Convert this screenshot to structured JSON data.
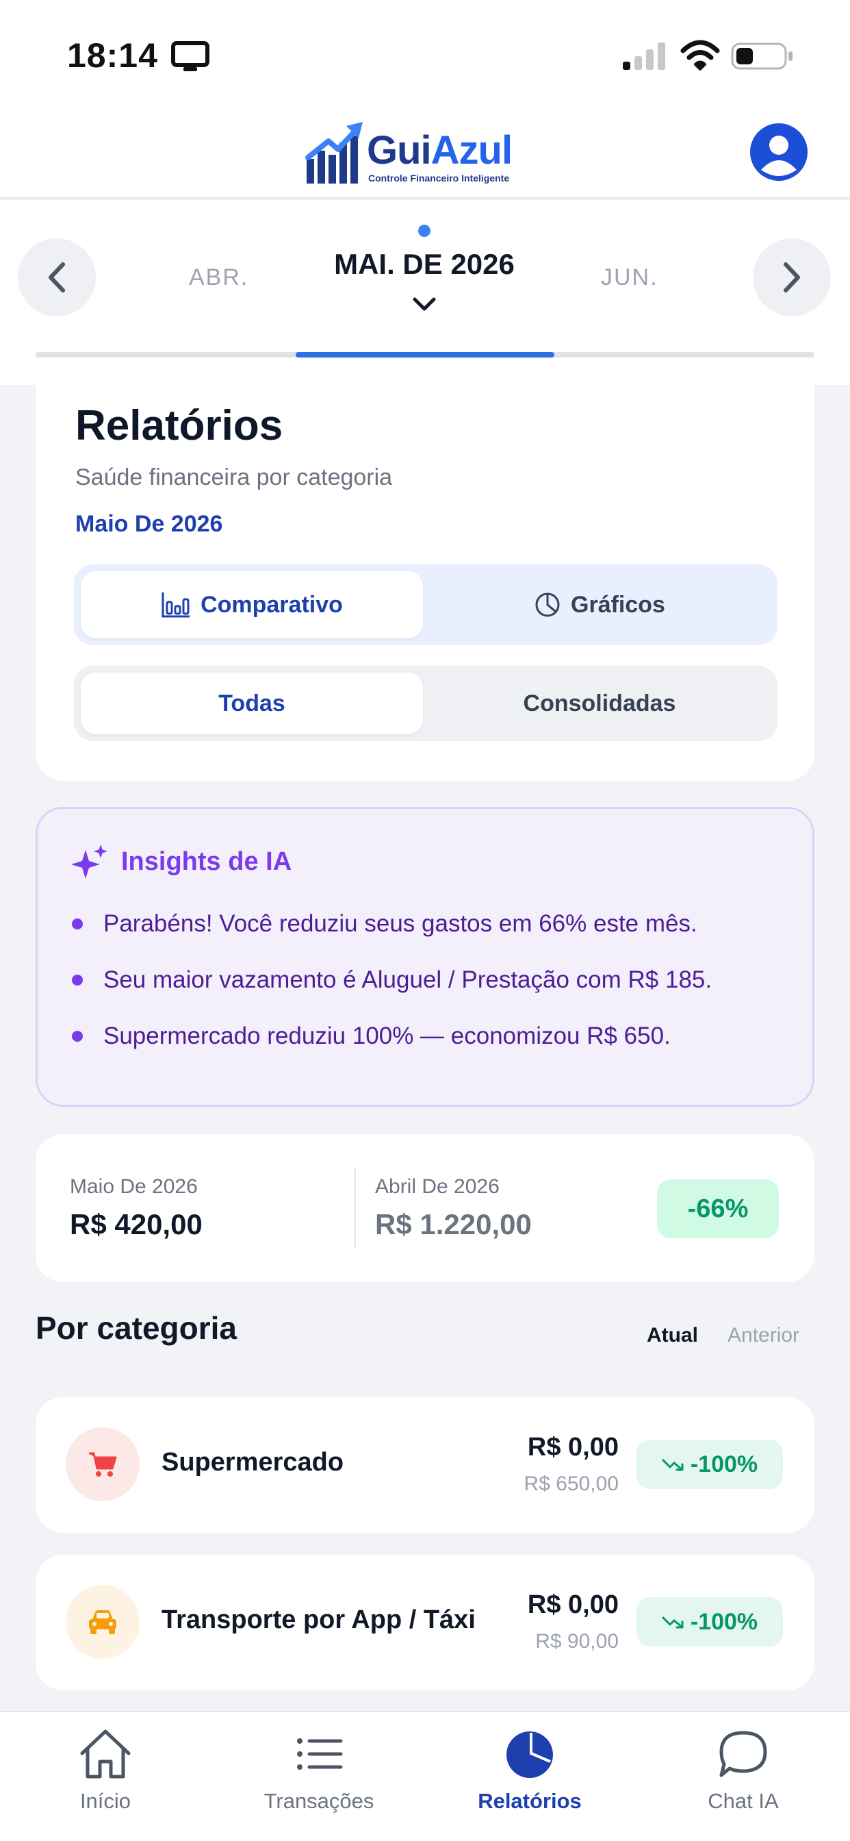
{
  "status_bar": {
    "time": "18:14",
    "icons": [
      "screen-mirroring-icon",
      "cellular-signal-icon",
      "wifi-icon",
      "battery-icon"
    ]
  },
  "header": {
    "brand_part1": "Gui",
    "brand_part2": "Azul",
    "tagline": "Controle Financeiro Inteligente",
    "avatar_icon": "user-avatar-icon"
  },
  "month_selector": {
    "previous": "ABR.",
    "current": "MAI. DE 2026",
    "next": "JUN.",
    "progress_fraction": 0.33
  },
  "reports": {
    "title": "Relatórios",
    "subtitle": "Saúde financeira por categoria",
    "period": "Maio De 2026",
    "view_tabs": [
      {
        "label": "Comparativo",
        "icon": "bar-chart-icon",
        "active": true
      },
      {
        "label": "Gráficos",
        "icon": "pie-chart-icon",
        "active": false
      }
    ],
    "filter_tabs": [
      {
        "label": "Todas",
        "active": true
      },
      {
        "label": "Consolidadas",
        "active": false
      }
    ]
  },
  "insights": {
    "title": "Insights de IA",
    "icon": "sparkles-icon",
    "items": [
      "Parabéns! Você reduziu seus gastos em 66% este mês.",
      "Seu maior vazamento é Aluguel / Prestação com R$ 185.",
      "Supermercado reduziu 100% — economizou R$ 650."
    ]
  },
  "summary": {
    "current_label": "Maio De 2026",
    "current_value": "R$ 420,00",
    "previous_label": "Abril De 2026",
    "previous_value": "R$ 1.220,00",
    "change": "-66%"
  },
  "categories": {
    "title": "Por categoria",
    "toggle_current": "Atual",
    "toggle_previous": "Anterior",
    "items": [
      {
        "name": "Supermercado",
        "icon": "shopping-cart-icon",
        "current": "R$ 0,00",
        "previous": "R$ 650,00",
        "change": "-100%"
      },
      {
        "name": "Transporte por App / Táxi",
        "icon": "car-icon",
        "current": "R$ 0,00",
        "previous": "R$ 90,00",
        "change": "-100%"
      }
    ]
  },
  "colors": {
    "primary": "#1e40af",
    "accent": "#2f6fe4",
    "insight_purple": "#7c3aed",
    "positive_green": "#059669"
  },
  "tab_bar": {
    "items": [
      {
        "label": "Início",
        "icon": "home-icon",
        "active": false
      },
      {
        "label": "Transações",
        "icon": "list-icon",
        "active": false
      },
      {
        "label": "Relatórios",
        "icon": "pie-chart-icon",
        "active": true
      },
      {
        "label": "Chat IA",
        "icon": "chat-bubble-icon",
        "active": false
      }
    ]
  }
}
